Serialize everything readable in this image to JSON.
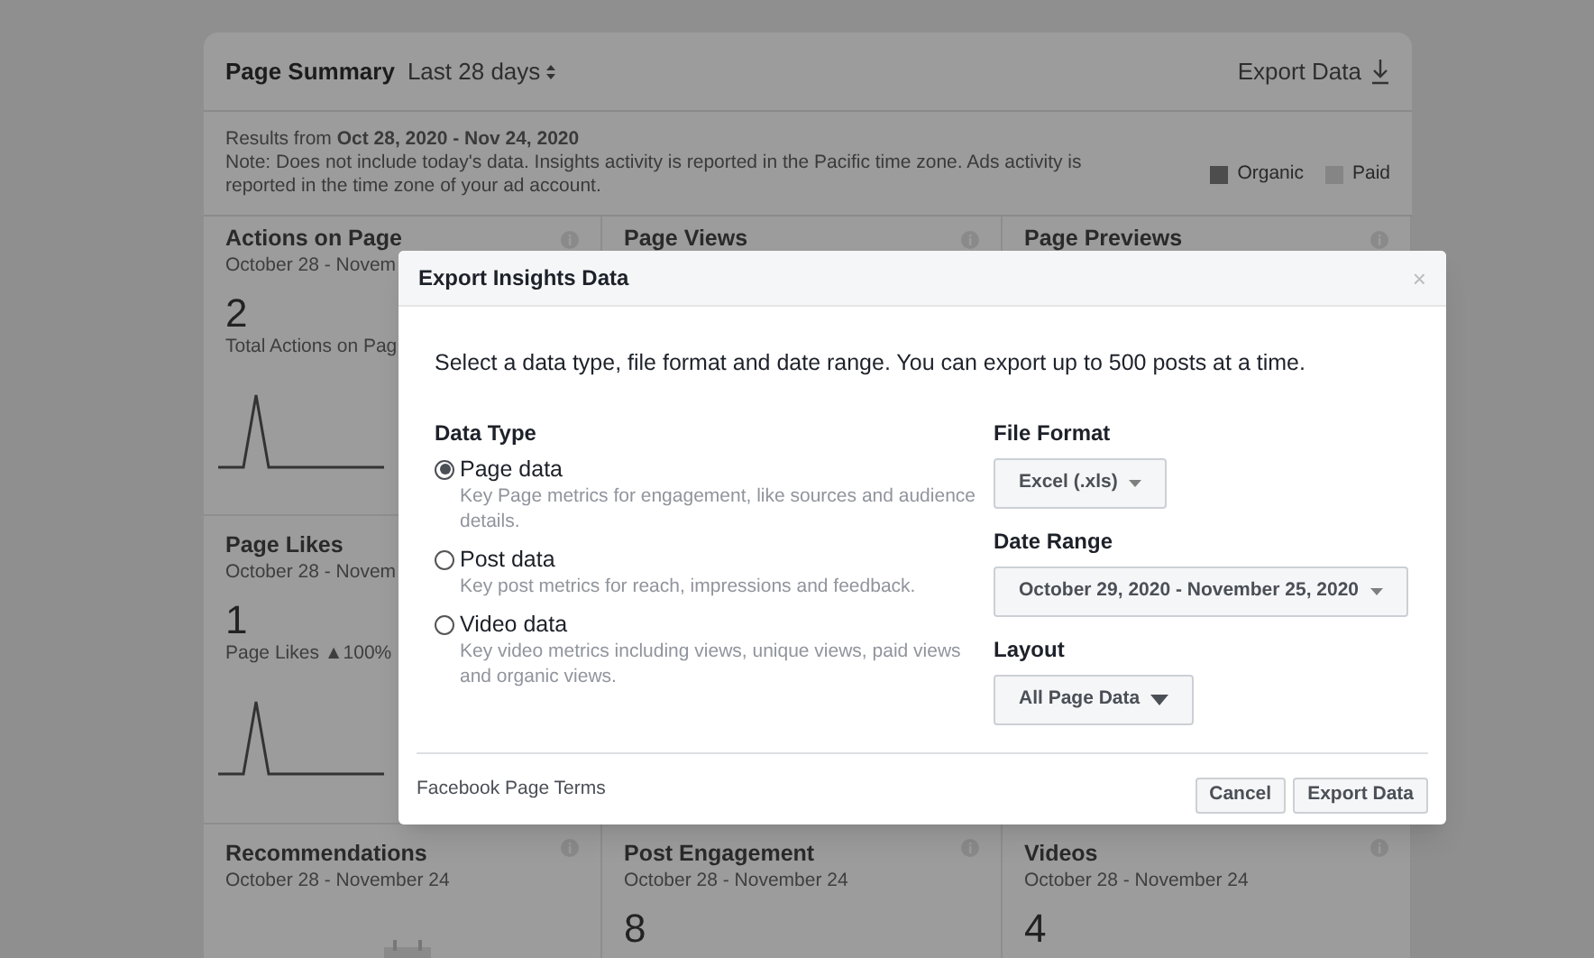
{
  "summary": {
    "title": "Page Summary",
    "period": "Last 28 days",
    "export_label": "Export Data"
  },
  "note": {
    "results": "Results from **Oct 28, 2020 - Nov 24, 2020**",
    "text": "Note: Does not include today's data. Insights activity is reported in the Pacific time zone. Ads activity is reported in the time zone of your ad account.",
    "legend": [
      {
        "label": "Organic",
        "color": "#4d4d4d"
      },
      {
        "label": "Paid",
        "color": "#858585"
      }
    ]
  },
  "rows": [
    [
      {
        "kind": "sparkline",
        "title": "Actions on Page",
        "date": "October 28 - Novem",
        "value": "2",
        "caption": "Total Actions on Pag"
      },
      {
        "kind": "empty",
        "title": "Page Views"
      },
      {
        "kind": "empty",
        "title": "Page Previews"
      }
    ],
    [
      {
        "kind": "sparkline",
        "title": "Page Likes",
        "date": "October 28 - Novem",
        "value": "1",
        "caption": "Page Likes ▲100%"
      }
    ],
    [
      {
        "kind": "icon",
        "title": "Recommendations",
        "date": "October 28 - November 24"
      },
      {
        "kind": "number",
        "title": "Post Engagement",
        "date": "October 28 - November 24",
        "value": "8"
      },
      {
        "kind": "number",
        "title": "Videos",
        "date": "October 28 - November 24",
        "value": "4"
      }
    ]
  ],
  "modal": {
    "title": "Export Insights Data",
    "close": "×",
    "intro": "Select a data type, file format and date range. You can export up to 500 posts at a time.",
    "data_type": {
      "label": "Data Type",
      "options": [
        {
          "label": "Page data",
          "description": "Key Page metrics for engagement, like sources and audience details.",
          "selected": true
        },
        {
          "label": "Post data",
          "description": "Key post metrics for reach, impressions and feedback.",
          "selected": false
        },
        {
          "label": "Video data",
          "description": "Key video metrics including views, unique views, paid views and organic views.",
          "selected": false
        }
      ]
    },
    "fields": [
      {
        "label": "File Format",
        "value": "Excel (.xls)"
      },
      {
        "label": "Date Range",
        "value": "October 29, 2020 - November 25, 2020"
      },
      {
        "label": "Layout",
        "value": "All Page Data"
      }
    ],
    "terms_link": "Facebook Page Terms",
    "buttons": [
      "Cancel",
      "Export Data"
    ]
  }
}
